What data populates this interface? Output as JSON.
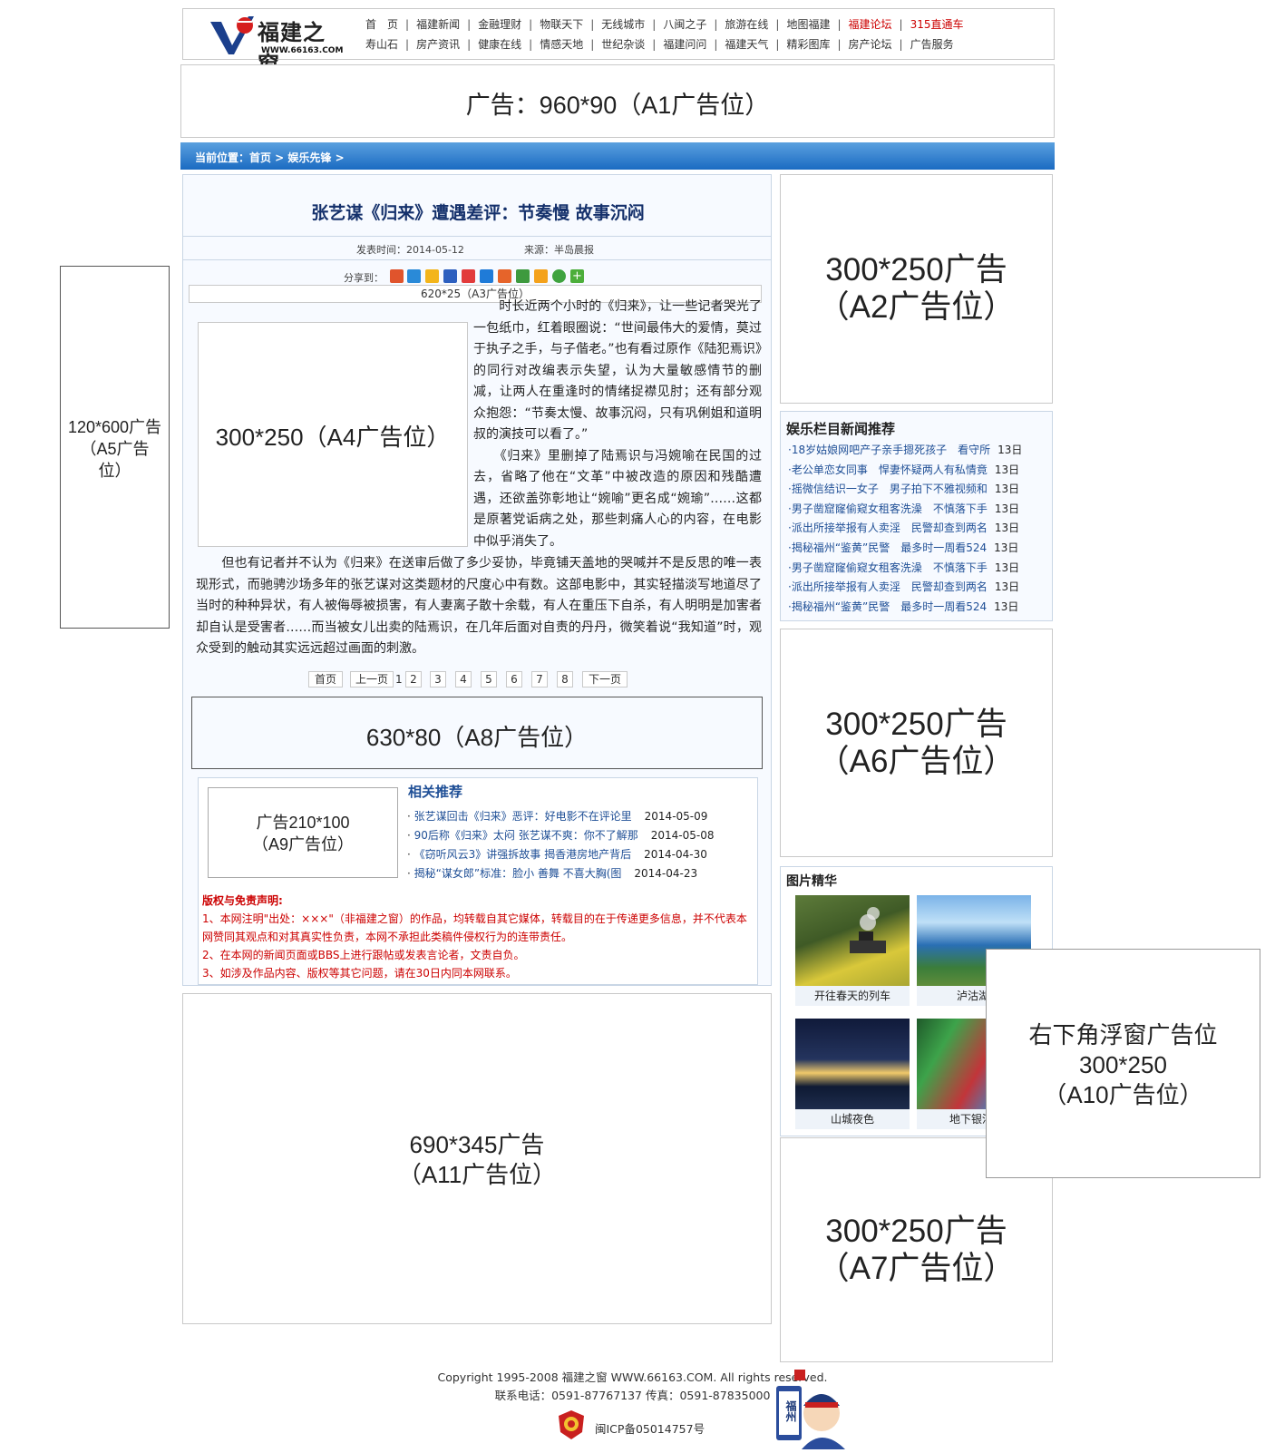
{
  "header": {
    "logo_name": "福建之窗",
    "logo_url": "WWW.66163.COM",
    "nav_row1": [
      "首　页",
      "福建新闻",
      "金融理财",
      "物联天下",
      "无线城市",
      "八闽之子",
      "旅游在线",
      "地图福建",
      "福建论坛",
      "315直通车"
    ],
    "nav_row1_red": [
      false,
      false,
      false,
      false,
      false,
      false,
      false,
      false,
      true,
      true
    ],
    "nav_row2": [
      "寿山石",
      "房产资讯",
      "健康在线",
      "情感天地",
      "世纪杂谈",
      "福建问问",
      "福建天气",
      "精彩图库",
      "房产论坛",
      "广告服务"
    ]
  },
  "ads": {
    "a1": "广告：960*90（A1广告位）",
    "a2_line1": "300*250广告",
    "a2_line2": "（A2广告位）",
    "a3": "620*25（A3广告位）",
    "a4": "300*250（A4广告位）",
    "a5_line1": "120*600广告",
    "a5_line2": "（A5广告",
    "a5_line3": "位）",
    "a6_line1": "300*250广告",
    "a6_line2": "（A6广告位）",
    "a7_line1": "300*250广告",
    "a7_line2": "（A7广告位）",
    "a8": "630*80（A8广告位）",
    "a9_line1": "广告210*100",
    "a9_line2": "（A9广告位）",
    "a10_line1": "右下角浮窗广告位",
    "a10_line2": "300*250",
    "a10_line3": "（A10广告位）",
    "a11_line1": "690*345广告",
    "a11_line2": "（A11广告位）"
  },
  "breadcrumb": "当前位置：首页 > 娱乐先锋 >",
  "article": {
    "title": "张艺谋《归来》遭遇差评：节奏慢 故事沉闷",
    "date_label": "发表时间：2014-05-12",
    "source_label": "来源：半岛晨报",
    "share_label": "分享到：",
    "para1": "　　时长近两个小时的《归来》，让一些记者哭光了一包纸巾，红着眼圈说：“世间最伟大的爱情，莫过于执子之手，与子偕老。”也有看过原作《陆犯焉识》的同行对改编表示失望，认为大量敏感情节的删减，让两人在重逢时的情绪捉襟见肘；还有部分观众抱怨：“节奏太慢、故事沉闷，只有巩俐姐和道明叔的演技可以看了。”",
    "para2": "　　《归来》里删掉了陆焉识与冯婉喻在民国的过去，省略了他在“文革”中被改造的原因和残酷遭遇，还欲盖弥彰地让“婉喻”更名成“婉瑜”……这都是原著党诟病之处，那些刺痛人心的内容，在电影中似乎消失了。",
    "para3": "　　但也有记者并不认为《归来》在送审后做了多少妥协，毕竟铺天盖地的哭喊并不是反思的唯一表现形式，而驰骋沙场多年的张艺谋对这类题材的尺度心中有数。这部电影中，其实轻描淡写地道尽了当时的种种异状，有人被侮辱被损害，有人妻离子散十余载，有人在重压下自杀，有人明明是加害者却自认是受害者……而当被女儿出卖的陆焉识，在几年后面对自责的丹丹，微笑着说“我知道”时，观众受到的触动其实远远超过画面的刺激。"
  },
  "pager": {
    "first": "首页",
    "prev": "上一页",
    "current": "1",
    "pages": [
      "2",
      "3",
      "4",
      "5",
      "6",
      "7",
      "8"
    ],
    "next": "下一页"
  },
  "related": {
    "title": "相关推荐",
    "items": [
      {
        "title": "张艺谋回击《归来》恶评：好电影不在评论里",
        "date": "2014-05-09"
      },
      {
        "title": "90后称《归来》太闷 张艺谋不爽：你不了解那",
        "date": "2014-05-08"
      },
      {
        "title": "《窃听风云3》讲强拆故事 揭香港房地产背后",
        "date": "2014-04-30"
      },
      {
        "title": "揭秘“谋女郎”标准：脸小 善舞 不喜大胸(图",
        "date": "2014-04-23"
      }
    ]
  },
  "disclaimer": {
    "title": "版权与免责声明:",
    "line1": "1、本网注明\"出处：×××\"（非福建之窗）的作品，均转载自其它媒体，转载目的在于传递更多信息，并不代表本",
    "line2": "网赞同其观点和对其真实性负责，本网不承担此类稿件侵权行为的连带责任。",
    "line3": "2、在本网的新闻页面或BBS上进行跟帖或发表言论者，文责自负。",
    "line4": "3、如涉及作品内容、版权等其它问题，请在30日内同本网联系。"
  },
  "news": {
    "title": "娱乐栏目新闻推荐",
    "items": [
      {
        "title": "·18岁姑娘网吧产子亲手摁死孩子　看守所",
        "date": "13日"
      },
      {
        "title": "·老公单恋女同事　悍妻怀疑两人有私情竟",
        "date": "13日"
      },
      {
        "title": "·摇微信结识一女子　男子拍下不雅视频和",
        "date": "13日"
      },
      {
        "title": "·男子凿窟窿偷窥女租客洗澡　不慎落下手",
        "date": "13日"
      },
      {
        "title": "·派出所接举报有人卖淫　民警却查到两名",
        "date": "13日"
      },
      {
        "title": "·揭秘福州“鉴黄”民警　最多时一周看524",
        "date": "13日"
      },
      {
        "title": "·男子凿窟窿偷窥女租客洗澡　不慎落下手",
        "date": "13日"
      },
      {
        "title": "·派出所接举报有人卖淫　民警却查到两名",
        "date": "13日"
      },
      {
        "title": "·揭秘福州“鉴黄”民警　最多时一周看524",
        "date": "13日"
      }
    ]
  },
  "photos": {
    "title": "图片精华",
    "items": [
      "开往春天的列车",
      "泸沽湖",
      "山城夜色",
      "地下银河"
    ]
  },
  "footer": {
    "copyright": "Copyright 1995-2008 福建之窗 WWW.66163.COM. All rights reserved.",
    "contact": "联系电话：0591-87767137 传真：0591-87835000",
    "icp": "闽ICP备05014757号",
    "police_badge": "福州"
  },
  "colors": {
    "accent_blue": "#1b6bc2",
    "title_navy": "#14306b",
    "link_blue": "#1f4f96",
    "alert_red": "#cc0000"
  }
}
